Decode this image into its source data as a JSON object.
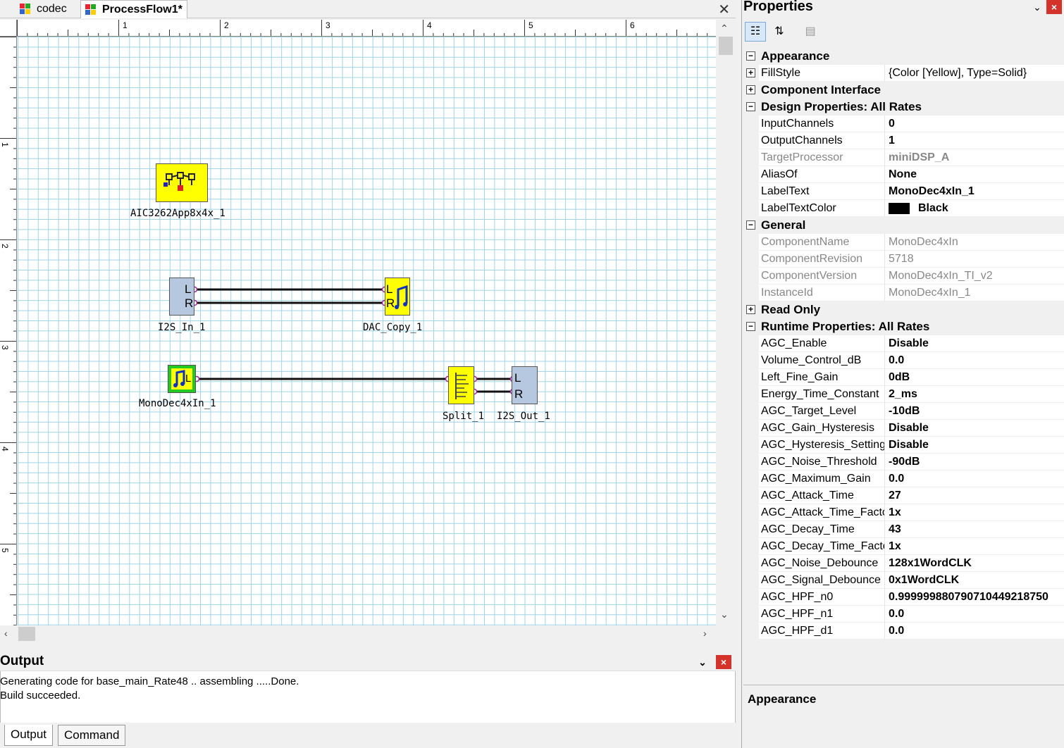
{
  "tabs": [
    {
      "label": "codec",
      "active": false
    },
    {
      "label": "ProcessFlow1*",
      "active": true
    }
  ],
  "ruler": {
    "top": [
      "1",
      "2",
      "3",
      "4",
      "5",
      "6"
    ],
    "left": [
      "1",
      "2",
      "3",
      "4",
      "5"
    ]
  },
  "canvas": {
    "blocks": {
      "aic": "AIC3262App8x4x_1",
      "i2s_in": "I2S_In_1",
      "dac_copy": "DAC_Copy_1",
      "mono": "MonoDec4xIn_1",
      "split": "Split_1",
      "i2s_out": "I2S_Out_1"
    },
    "pins": {
      "l": "L",
      "r": "R"
    }
  },
  "output": {
    "title": "Output",
    "lines": [
      "Generating code for base_main_Rate48 ..  assembling .....Done.",
      "Build succeeded."
    ],
    "tabs": [
      "Output",
      "Command"
    ]
  },
  "properties": {
    "title": "Properties",
    "rows": [
      {
        "type": "cat",
        "exp": "−",
        "name": "Appearance"
      },
      {
        "type": "prop",
        "exp": "+",
        "name": "FillStyle",
        "value": "{Color [Yellow], Type=Solid}",
        "bold": false
      },
      {
        "type": "cat",
        "exp": "+",
        "name": "Component Interface"
      },
      {
        "type": "cat",
        "exp": "−",
        "name": "Design Properties: All Rates"
      },
      {
        "type": "prop",
        "name": "InputChannels",
        "value": "0",
        "bold": true
      },
      {
        "type": "prop",
        "name": "OutputChannels",
        "value": "1",
        "bold": true
      },
      {
        "type": "prop",
        "name": "TargetProcessor",
        "value": "miniDSP_A",
        "bold": true,
        "dim": true
      },
      {
        "type": "prop",
        "name": "AliasOf",
        "value": "None",
        "bold": true
      },
      {
        "type": "prop",
        "name": "LabelText",
        "value": "MonoDec4xIn_1",
        "bold": true
      },
      {
        "type": "prop",
        "name": "LabelTextColor",
        "value": "Black",
        "bold": true,
        "swatch": "#000000"
      },
      {
        "type": "cat",
        "exp": "−",
        "name": "General"
      },
      {
        "type": "prop",
        "name": "ComponentName",
        "value": "MonoDec4xIn",
        "bold": false,
        "dim": true
      },
      {
        "type": "prop",
        "name": "ComponentRevision",
        "value": "5718",
        "bold": false,
        "dim": true
      },
      {
        "type": "prop",
        "name": "ComponentVersion",
        "value": "MonoDec4xIn_TI_v2",
        "bold": false,
        "dim": true
      },
      {
        "type": "prop",
        "name": "InstanceId",
        "value": "MonoDec4xIn_1",
        "bold": false,
        "dim": true
      },
      {
        "type": "cat",
        "exp": "+",
        "name": "Read Only"
      },
      {
        "type": "cat",
        "exp": "−",
        "name": "Runtime Properties: All Rates"
      },
      {
        "type": "prop",
        "name": "AGC_Enable",
        "value": "Disable",
        "bold": true
      },
      {
        "type": "prop",
        "name": "Volume_Control_dB",
        "value": "0.0",
        "bold": true
      },
      {
        "type": "prop",
        "name": "Left_Fine_Gain",
        "value": "0dB",
        "bold": true
      },
      {
        "type": "prop",
        "name": "Energy_Time_Constant",
        "value": "2_ms",
        "bold": true
      },
      {
        "type": "prop",
        "name": "AGC_Target_Level",
        "value": "-10dB",
        "bold": true
      },
      {
        "type": "prop",
        "name": "AGC_Gain_Hysteresis",
        "value": "Disable",
        "bold": true
      },
      {
        "type": "prop",
        "name": "AGC_Hysteresis_Setting",
        "value": "Disable",
        "bold": true
      },
      {
        "type": "prop",
        "name": "AGC_Noise_Threshold",
        "value": "-90dB",
        "bold": true
      },
      {
        "type": "prop",
        "name": "AGC_Maximum_Gain",
        "value": "0.0",
        "bold": true
      },
      {
        "type": "prop",
        "name": "AGC_Attack_Time",
        "value": "27",
        "bold": true
      },
      {
        "type": "prop",
        "name": "AGC_Attack_Time_Factor",
        "value": "1x",
        "bold": true
      },
      {
        "type": "prop",
        "name": "AGC_Decay_Time",
        "value": "43",
        "bold": true
      },
      {
        "type": "prop",
        "name": "AGC_Decay_Time_Factor",
        "value": "1x",
        "bold": true
      },
      {
        "type": "prop",
        "name": "AGC_Noise_Debounce",
        "value": "128x1WordCLK",
        "bold": true
      },
      {
        "type": "prop",
        "name": "AGC_Signal_Debounce",
        "value": "0x1WordCLK",
        "bold": true
      },
      {
        "type": "prop",
        "name": "AGC_HPF_n0",
        "value": "0.999999880790710449218750",
        "bold": true
      },
      {
        "type": "prop",
        "name": "AGC_HPF_n1",
        "value": "0.0",
        "bold": true
      },
      {
        "type": "prop",
        "name": "AGC_HPF_d1",
        "value": "0.0",
        "bold": true
      }
    ],
    "description_title": "Appearance"
  },
  "colors": {
    "block_yellow": "#ffff00",
    "block_blue": "#b6c8e0",
    "block_green": "#22c922",
    "grid_line": "#9fd3e8",
    "close_red": "#d4332c"
  }
}
